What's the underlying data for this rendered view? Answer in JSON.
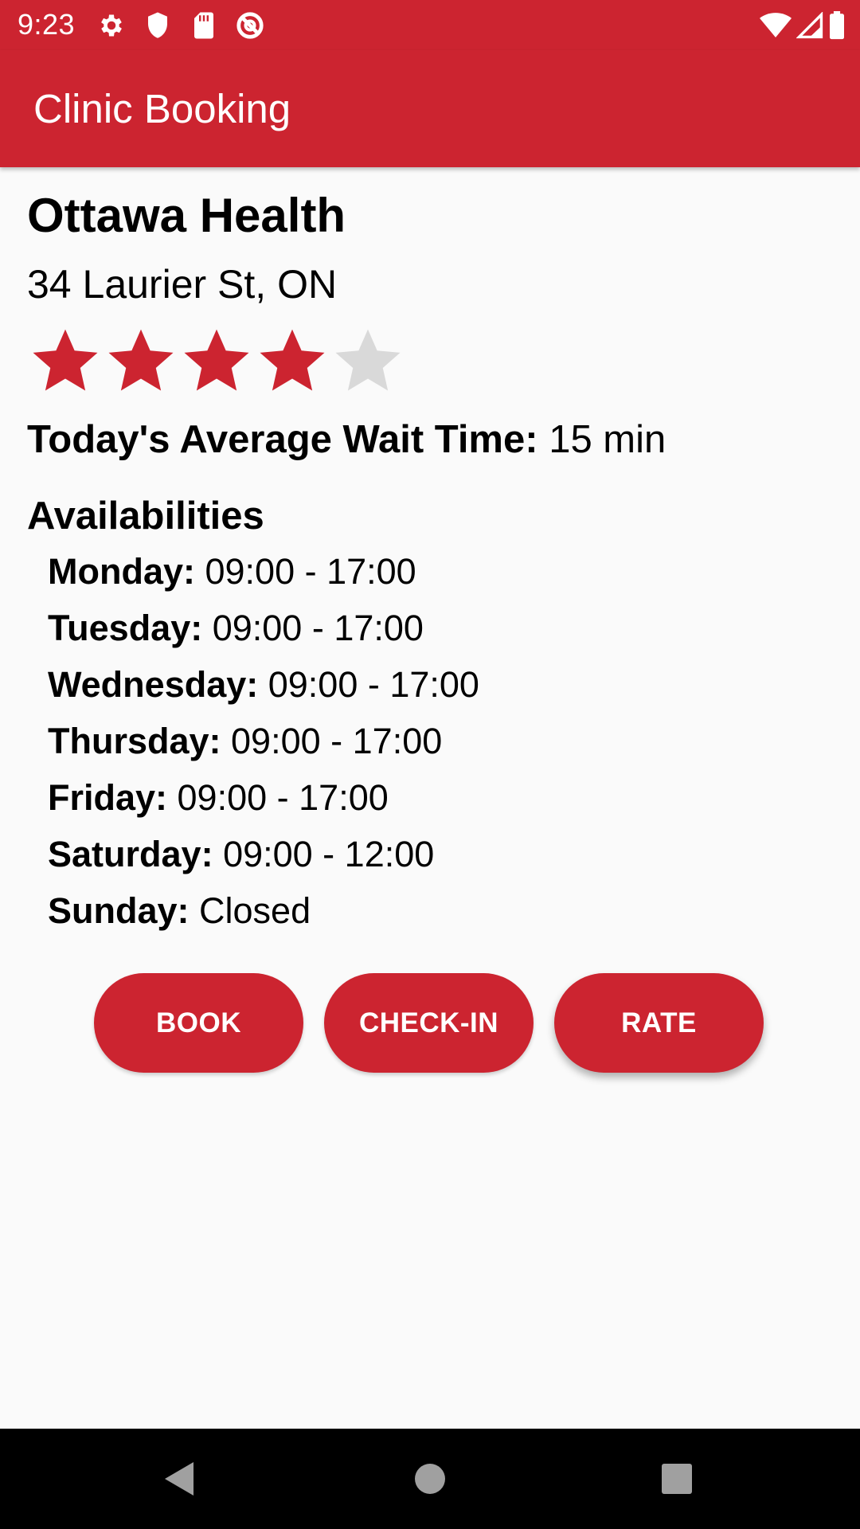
{
  "status_bar": {
    "time": "9:23",
    "left_icons": [
      "settings-icon",
      "shield-icon",
      "sd-card-icon",
      "data-saver-icon"
    ],
    "right_icons": [
      "wifi-icon",
      "cell-signal-icon",
      "battery-icon"
    ]
  },
  "app_bar": {
    "title": "Clinic Booking"
  },
  "clinic": {
    "name": "Ottawa Health",
    "address": "34 Laurier St, ON",
    "rating": 4,
    "rating_max": 5,
    "wait_label": "Today's Average Wait Time:",
    "wait_value": " 15 min"
  },
  "availabilities": {
    "heading": "Availabilities",
    "days": [
      {
        "day": "Monday:",
        "hours": " 09:00 - 17:00"
      },
      {
        "day": "Tuesday:",
        "hours": " 09:00 - 17:00"
      },
      {
        "day": "Wednesday:",
        "hours": " 09:00 - 17:00"
      },
      {
        "day": "Thursday:",
        "hours": " 09:00 - 17:00"
      },
      {
        "day": "Friday:",
        "hours": " 09:00 - 17:00"
      },
      {
        "day": "Saturday:",
        "hours": " 09:00 - 12:00"
      },
      {
        "day": "Sunday:",
        "hours": " Closed"
      }
    ]
  },
  "actions": {
    "book": "BOOK",
    "check_in": "CHECK-IN",
    "rate": "RATE"
  },
  "nav_bar": {
    "icons": [
      "back-icon",
      "home-icon",
      "recents-icon"
    ]
  },
  "colors": {
    "primary": "#cc2430",
    "star_filled": "#cc2430",
    "star_empty": "#d9d9d9",
    "background": "#fafafa"
  }
}
